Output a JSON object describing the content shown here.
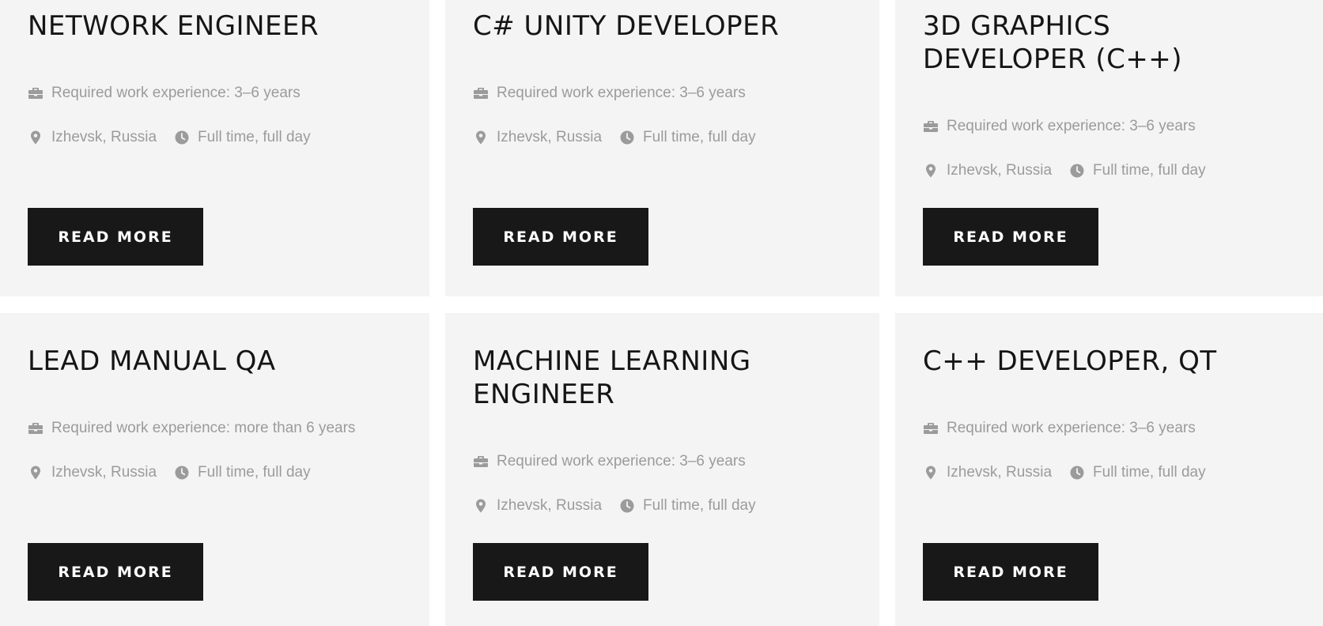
{
  "colors": {
    "card_bg": "#f4f4f4",
    "button_bg": "#181818",
    "button_text": "#ffffff",
    "title_text": "#151515",
    "meta_text": "#9b9b9b"
  },
  "icons": {
    "experience": "briefcase-icon",
    "location": "map-pin-icon",
    "schedule": "clock-icon"
  },
  "jobs": [
    {
      "title": "NETWORK ENGINEER",
      "experience": "Required work experience: 3–6 years",
      "location": "Izhevsk, Russia",
      "schedule": "Full time, full day",
      "button_label": "READ MORE"
    },
    {
      "title": "C# UNITY DEVELOPER",
      "experience": "Required work experience: 3–6 years",
      "location": "Izhevsk, Russia",
      "schedule": "Full time, full day",
      "button_label": "READ MORE"
    },
    {
      "title": "3D GRAPHICS DEVELOPER (C++)",
      "experience": "Required work experience: 3–6 years",
      "location": "Izhevsk, Russia",
      "schedule": "Full time, full day",
      "button_label": "READ MORE"
    },
    {
      "title": "LEAD MANUAL QA",
      "experience": "Required work experience: more than 6 years",
      "location": "Izhevsk, Russia",
      "schedule": "Full time, full day",
      "button_label": "READ MORE"
    },
    {
      "title": "MACHINE LEARNING ENGINEER",
      "experience": "Required work experience: 3–6 years",
      "location": "Izhevsk, Russia",
      "schedule": "Full time, full day",
      "button_label": "READ MORE"
    },
    {
      "title": "C++ DEVELOPER, QT",
      "experience": "Required work experience: 3–6 years",
      "location": "Izhevsk, Russia",
      "schedule": "Full time, full day",
      "button_label": "READ MORE"
    }
  ]
}
